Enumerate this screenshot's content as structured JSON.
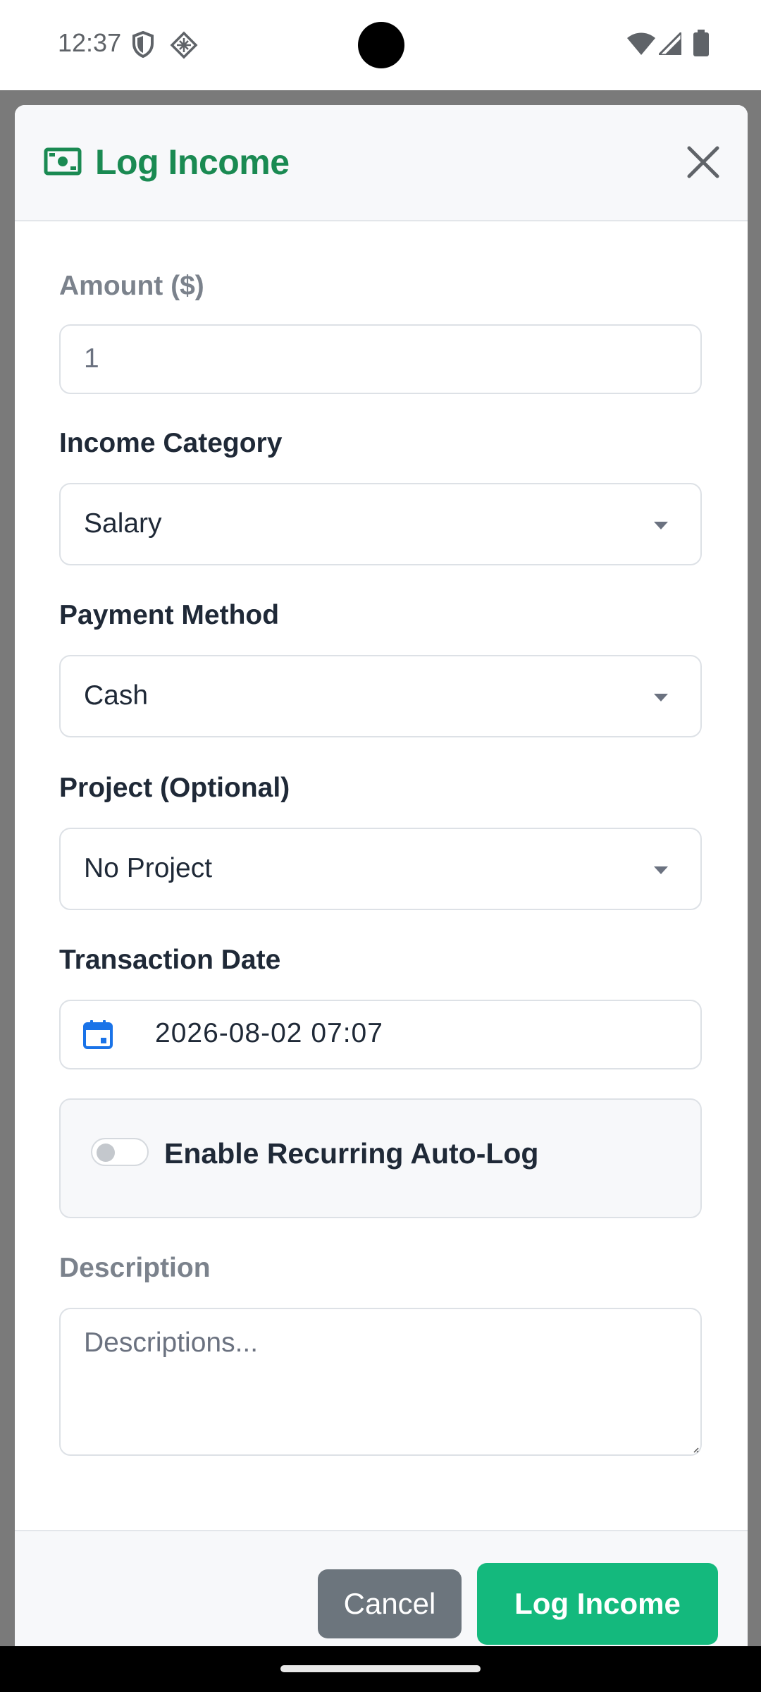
{
  "status_bar": {
    "time": "12:37",
    "icons": [
      "shield-icon",
      "vpn-icon",
      "wifi-icon",
      "signal-icon",
      "battery-icon"
    ]
  },
  "modal": {
    "title": "Log Income",
    "title_icon": "cash-icon",
    "title_color": "#1a8a52",
    "close_icon": "close-icon"
  },
  "form": {
    "amount": {
      "label": "Amount ($)",
      "value": "1"
    },
    "category": {
      "label": "Income Category",
      "selected": "Salary"
    },
    "payment_method": {
      "label": "Payment Method",
      "selected": "Cash"
    },
    "project": {
      "label": "Project (Optional)",
      "selected": "No Project"
    },
    "transaction_date": {
      "label": "Transaction Date",
      "value": "2026-08-02 07:07",
      "icon": "calendar-icon"
    },
    "recurring": {
      "label": "Enable Recurring Auto-Log",
      "enabled": false
    },
    "description": {
      "label": "Description",
      "placeholder": "Descriptions..."
    }
  },
  "footer": {
    "cancel_label": "Cancel",
    "submit_label": "Log Income",
    "submit_color": "#14b97d"
  }
}
